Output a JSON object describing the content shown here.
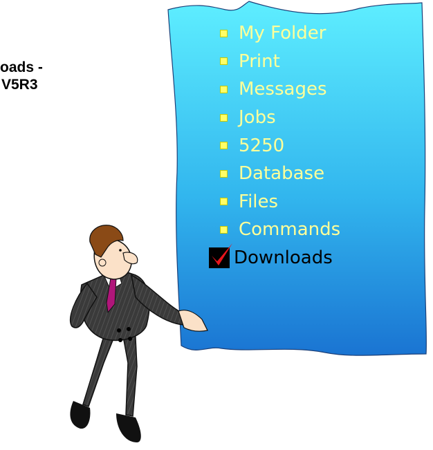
{
  "heading": {
    "line1": "oads -",
    "line2": "V5R3"
  },
  "menu": {
    "items": [
      {
        "label": "My Folder"
      },
      {
        "label": "Print"
      },
      {
        "label": "Messages"
      },
      {
        "label": "Jobs"
      },
      {
        "label": "5250"
      },
      {
        "label": "Database"
      },
      {
        "label": "Files"
      },
      {
        "label": "Commands"
      },
      {
        "label": "Downloads",
        "selected": true
      }
    ],
    "selected_marker": "check-icon"
  },
  "colors": {
    "panel_top": "#5eeeff",
    "panel_bottom": "#1e7fd6",
    "menu_text": "#ffff99",
    "bullet": "#ffff66",
    "selected_text": "#000000",
    "check": "#e8151d"
  }
}
